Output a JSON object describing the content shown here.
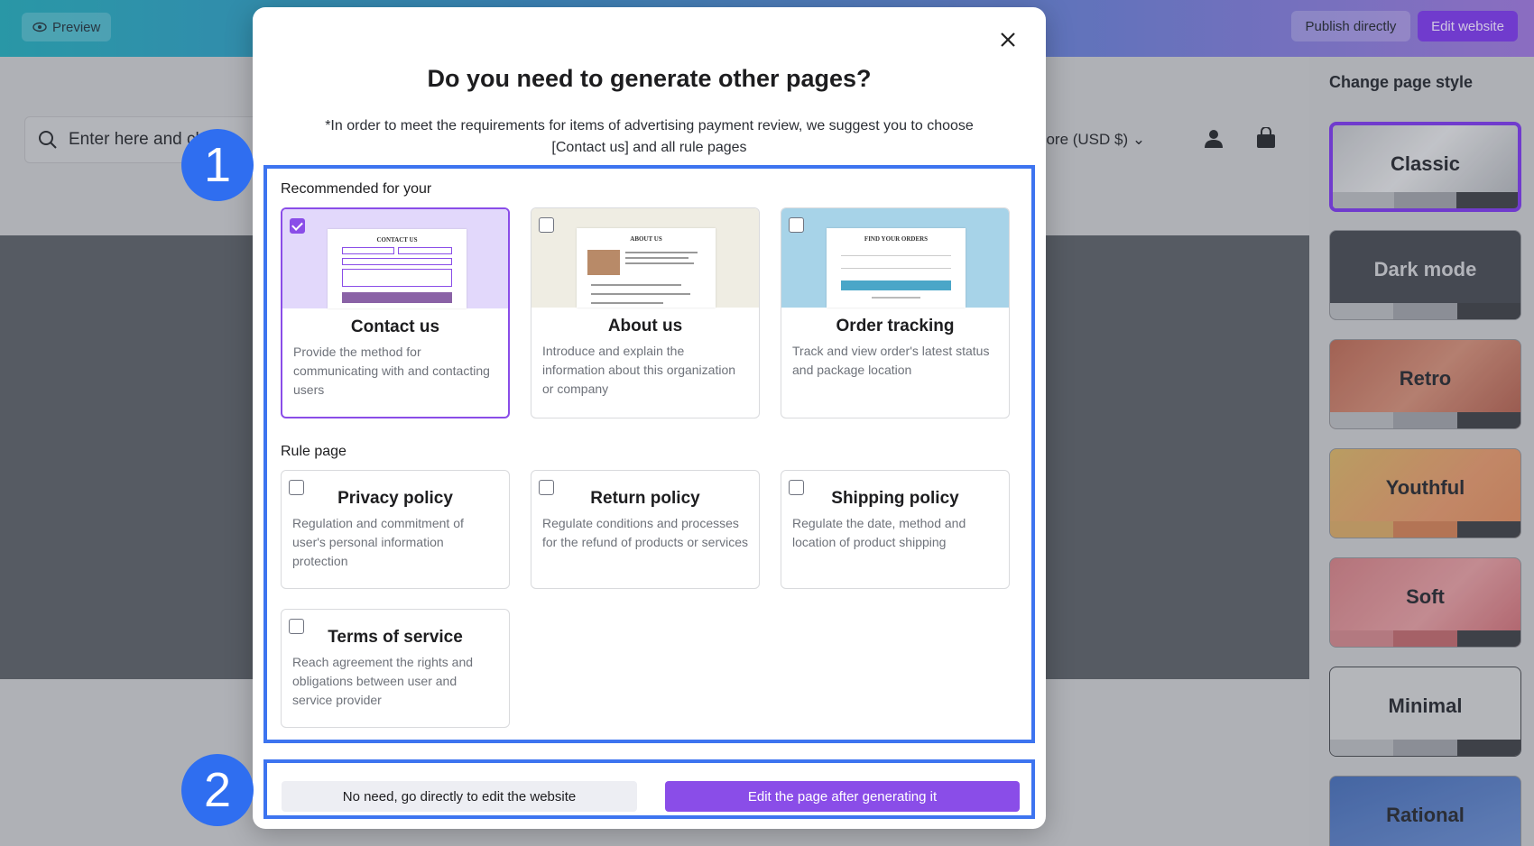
{
  "topbar": {
    "preview_label": "Preview",
    "publish_label": "Publish directly",
    "edit_label": "Edit website"
  },
  "store": {
    "search_placeholder": "Enter here and cl",
    "currency": "pore (USD $)"
  },
  "sidebar": {
    "title": "Change page style",
    "styles": [
      {
        "label": "Classic",
        "selected": true
      },
      {
        "label": "Dark mode"
      },
      {
        "label": "Retro"
      },
      {
        "label": "Youthful"
      },
      {
        "label": "Soft"
      },
      {
        "label": "Minimal"
      },
      {
        "label": "Rational"
      }
    ]
  },
  "modal": {
    "title": "Do you need to generate other pages?",
    "note": "*In order to meet the requirements for items of advertising payment review, we suggest you to choose [Contact us] and all rule pages",
    "recommended_label": "Recommended for your",
    "rule_label": "Rule page",
    "recommended": [
      {
        "title": "Contact us",
        "desc": "Provide the method for communicating with and contacting users",
        "checked": true,
        "thumb_title": "CONTACT US"
      },
      {
        "title": "About us",
        "desc": "Introduce and explain the information about this organization or company",
        "checked": false,
        "thumb_title": "ABOUT US"
      },
      {
        "title": "Order tracking",
        "desc": "Track and view order's latest status and package location",
        "checked": false,
        "thumb_title": "FIND YOUR ORDERS"
      }
    ],
    "rules": [
      {
        "title": "Privacy policy",
        "desc": "Regulation and commitment of user's personal information protection",
        "checked": false
      },
      {
        "title": "Return policy",
        "desc": "Regulate conditions and processes for the refund of products or services",
        "checked": false
      },
      {
        "title": "Shipping policy",
        "desc": "Regulate the date, method and location of product shipping",
        "checked": false
      },
      {
        "title": "Terms of service",
        "desc": "Reach agreement the rights and obligations between user and service provider",
        "checked": false
      }
    ],
    "secondary_button": "No need, go directly to edit the website",
    "primary_button": "Edit the page after generating it"
  },
  "markers": [
    "1",
    "2"
  ],
  "colors": {
    "accent": "#8a4de8",
    "highlight": "#3d74f0",
    "marker": "#2f6ef0"
  }
}
